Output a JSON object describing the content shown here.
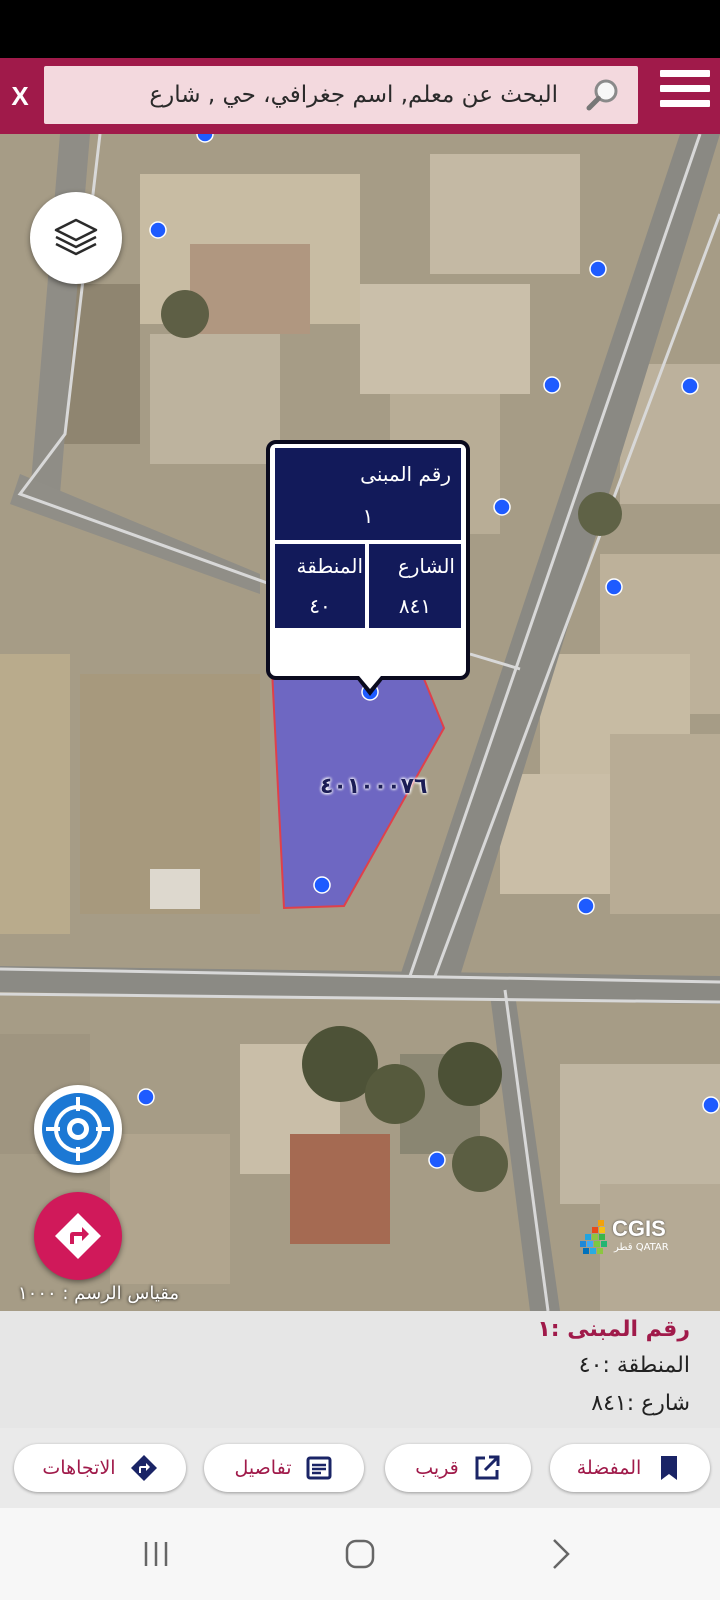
{
  "close_label": "X",
  "search": {
    "placeholder": "البحث عن معلم, اسم جغرافي، حي , شارع"
  },
  "popup": {
    "building_label": "رقم المبنى",
    "building_value": "١",
    "street_label": "الشارع",
    "street_value": "٨٤١",
    "zone_label": "المنطقة",
    "zone_value": "٤٠"
  },
  "parcel_id": "٤٠١٠٠٠٧٦",
  "scale": "مقياس الرسم : ١٠٠٠",
  "logo": {
    "name": "CGIS",
    "subtitle": "قطر QATAR"
  },
  "info_panel": {
    "title": "رقم المبنى  :١",
    "zone": "المنطقة  :٤٠",
    "street": "شارع  :٨٤١"
  },
  "actions": [
    {
      "label": "المفضلة",
      "icon": "bookmark-icon"
    },
    {
      "label": "قريب",
      "icon": "external-link-icon"
    },
    {
      "label": "تفاصيل",
      "icon": "details-icon"
    },
    {
      "label": "الاتجاهات",
      "icon": "directions-icon"
    }
  ],
  "colors": {
    "brand": "#a01a4a",
    "popup_cell": "#121a5a",
    "parcel_fill": "#5b55d6",
    "marker": "#1e5bff",
    "directions_fab": "#d0195a"
  }
}
